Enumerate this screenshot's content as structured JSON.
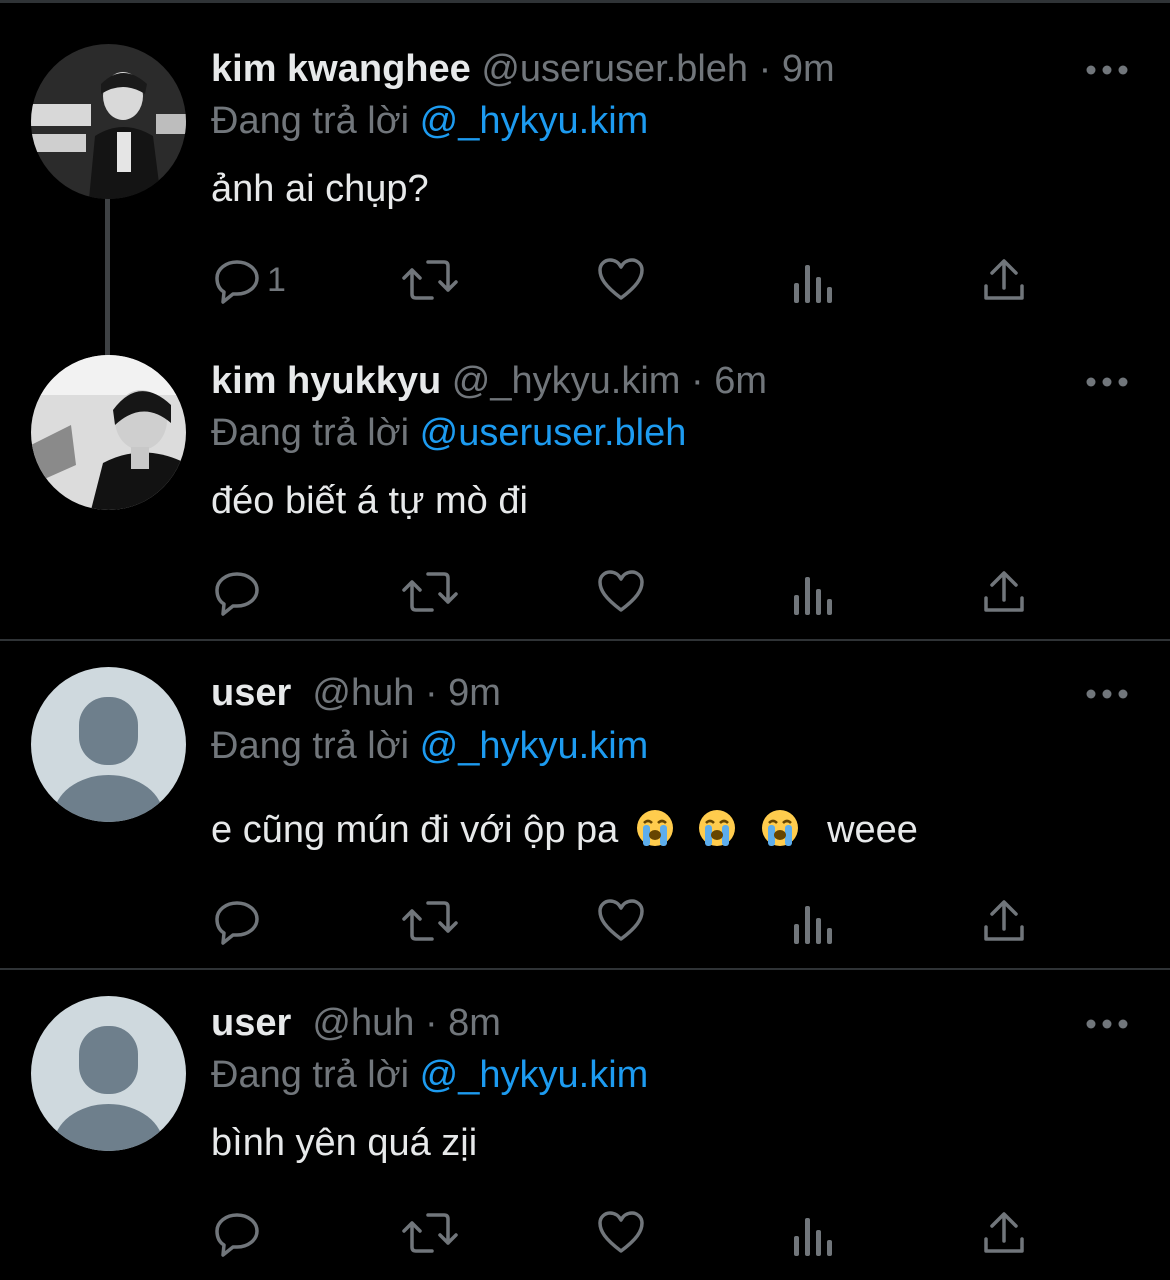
{
  "theme": {
    "background": "#000000",
    "text": "#e7e9ea",
    "muted": "#71767b",
    "link": "#1d9bf0",
    "divider": "#2f3336"
  },
  "reply_prefix": "Đang trả lời",
  "tweets": [
    {
      "display_name": "kim kwanghee",
      "handle": "@useruser.bleh",
      "separator": "·",
      "time": "9m",
      "reply_to": "@_hykyu.kim",
      "text": "ảnh ai chụp?",
      "reply_count": "1",
      "avatar": "photo-avatar"
    },
    {
      "display_name": "kim hyukkyu",
      "handle": "@_hykyu.kim",
      "separator": "·",
      "time": "6m",
      "reply_to": "@useruser.bleh",
      "text": "đéo biết á tự mò đi",
      "reply_count": "",
      "avatar": "photo-avatar"
    },
    {
      "display_name": "user",
      "handle": "@huh",
      "separator": "·",
      "time": "9m",
      "reply_to": "@_hykyu.kim",
      "text_before": "e cũng mún đi với ộp pa",
      "emojis": [
        "loudly-crying-face",
        "loudly-crying-face",
        "loudly-crying-face"
      ],
      "text_after": "weee",
      "reply_count": "",
      "avatar": "default-avatar"
    },
    {
      "display_name": "user",
      "handle": "@huh",
      "separator": "·",
      "time": "8m",
      "reply_to": "@_hykyu.kim",
      "text": "bình yên quá zịi",
      "reply_count": "",
      "avatar": "default-avatar"
    }
  ],
  "icons": {
    "reply": "reply-icon",
    "retweet": "retweet-icon",
    "like": "heart-icon",
    "views": "views-icon",
    "share": "share-icon",
    "more": "more-icon"
  }
}
